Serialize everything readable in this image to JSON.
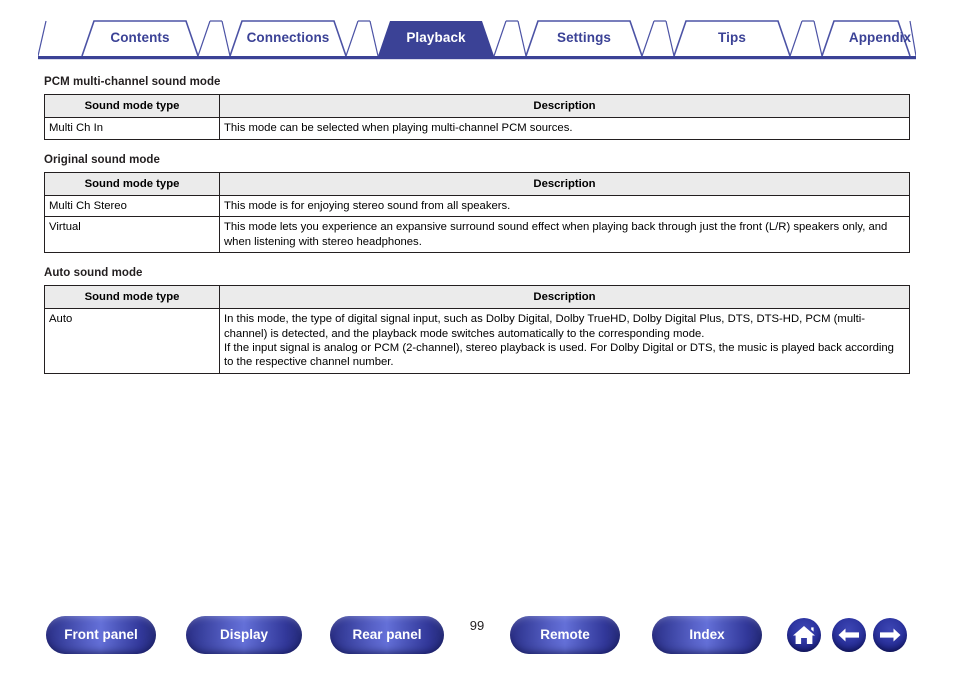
{
  "theme": {
    "brand_blue": "#3b4296",
    "tab_active_bg": "#3b4296",
    "table_header_bg": "#ebebeb",
    "text_color": "#231f20"
  },
  "tabs": [
    {
      "label": "Contents",
      "active": false
    },
    {
      "label": "Connections",
      "active": false
    },
    {
      "label": "Playback",
      "active": true
    },
    {
      "label": "Settings",
      "active": false
    },
    {
      "label": "Tips",
      "active": false
    },
    {
      "label": "Appendix",
      "active": false
    }
  ],
  "sections": [
    {
      "title": "PCM multi-channel sound mode",
      "headers": {
        "type": "Sound mode type",
        "description": "Description"
      },
      "rows": [
        {
          "type": "Multi Ch In",
          "lines": [
            "This mode can be selected when playing multi-channel PCM sources."
          ]
        }
      ]
    },
    {
      "title": "Original sound mode",
      "headers": {
        "type": "Sound mode type",
        "description": "Description"
      },
      "rows": [
        {
          "type": "Multi Ch Stereo",
          "lines": [
            "This mode is for enjoying stereo sound from all speakers."
          ]
        },
        {
          "type": "Virtual",
          "lines": [
            "This mode lets you experience an expansive surround sound effect when playing back through just the front (L/R) speakers only, and when listening with stereo headphones."
          ]
        }
      ]
    },
    {
      "title": "Auto sound mode",
      "headers": {
        "type": "Sound mode type",
        "description": "Description"
      },
      "rows": [
        {
          "type": "Auto",
          "lines": [
            "In this mode, the type of digital signal input, such as Dolby Digital, Dolby TrueHD, Dolby Digital Plus, DTS, DTS-HD, PCM (multi-channel) is detected, and the playback mode switches automatically to the corresponding mode.",
            "If the input signal is analog or PCM (2-channel), stereo playback is used. For Dolby Digital or DTS, the music is played back according to the respective channel number."
          ]
        }
      ]
    }
  ],
  "footer": {
    "buttons": [
      {
        "label": "Front panel"
      },
      {
        "label": "Display"
      },
      {
        "label": "Rear panel"
      },
      {
        "label": "Remote"
      },
      {
        "label": "Index"
      }
    ],
    "page_number": "99",
    "icons": [
      {
        "name": "home-icon"
      },
      {
        "name": "arrow-left-icon"
      },
      {
        "name": "arrow-right-icon"
      }
    ]
  }
}
